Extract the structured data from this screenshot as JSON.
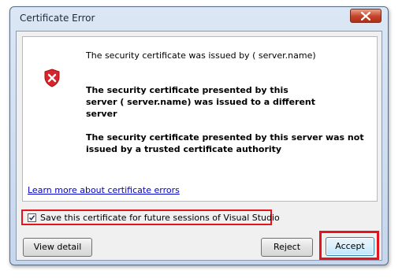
{
  "window": {
    "title": "Certificate Error"
  },
  "message": {
    "issued_by": "The security certificate was issued by ( server.name)",
    "error_1": "The security certificate presented by this server ( server.name) was issued to a different server",
    "error_2": "The security certificate presented by this server was not issued by a trusted certificate authority"
  },
  "learn_more_link": "Learn more about certificate errors",
  "save_checkbox": {
    "label": "Save this certificate for future sessions of Visual Studio",
    "checked": true
  },
  "buttons": {
    "view_detail": "View detail",
    "reject": "Reject",
    "accept": "Accept"
  },
  "icons": {
    "error": "error-shield-icon",
    "close": "close-icon",
    "check": "checkmark-icon"
  },
  "colors": {
    "highlight": "#e3141b",
    "error_icon": "#d7262b",
    "link": "#0000cc"
  }
}
